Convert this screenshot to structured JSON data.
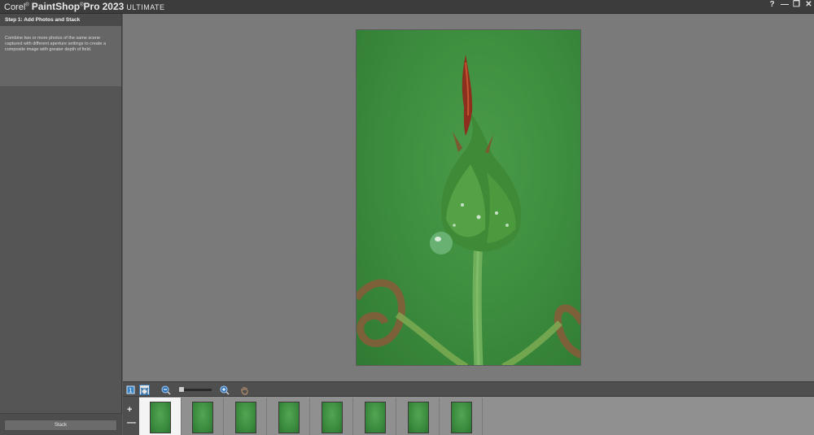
{
  "app": {
    "brand": "Corel",
    "product": "PaintShop",
    "suffix": "Pro",
    "version": "2023",
    "edition": "ULTIMATE"
  },
  "window_controls": {
    "help": "?",
    "minimize": "—",
    "restore": "❐",
    "close": "✕"
  },
  "left_panel": {
    "step_title": "Step 1: Add Photos and Stack",
    "step_description": "Combine two or more photos of the same scene captured with different aperture settings to create a composite image with greater depth of field.",
    "stack_button": "Stack"
  },
  "toolbar": {
    "icons": [
      "actual-size-icon",
      "fit-to-window-icon",
      "zoom-out-icon",
      "zoom-slider",
      "zoom-in-icon",
      "pan-hand-icon"
    ]
  },
  "filmstrip": {
    "add_label": "+",
    "remove_label": "—",
    "thumbnail_count": 8,
    "selected_index": 0
  }
}
